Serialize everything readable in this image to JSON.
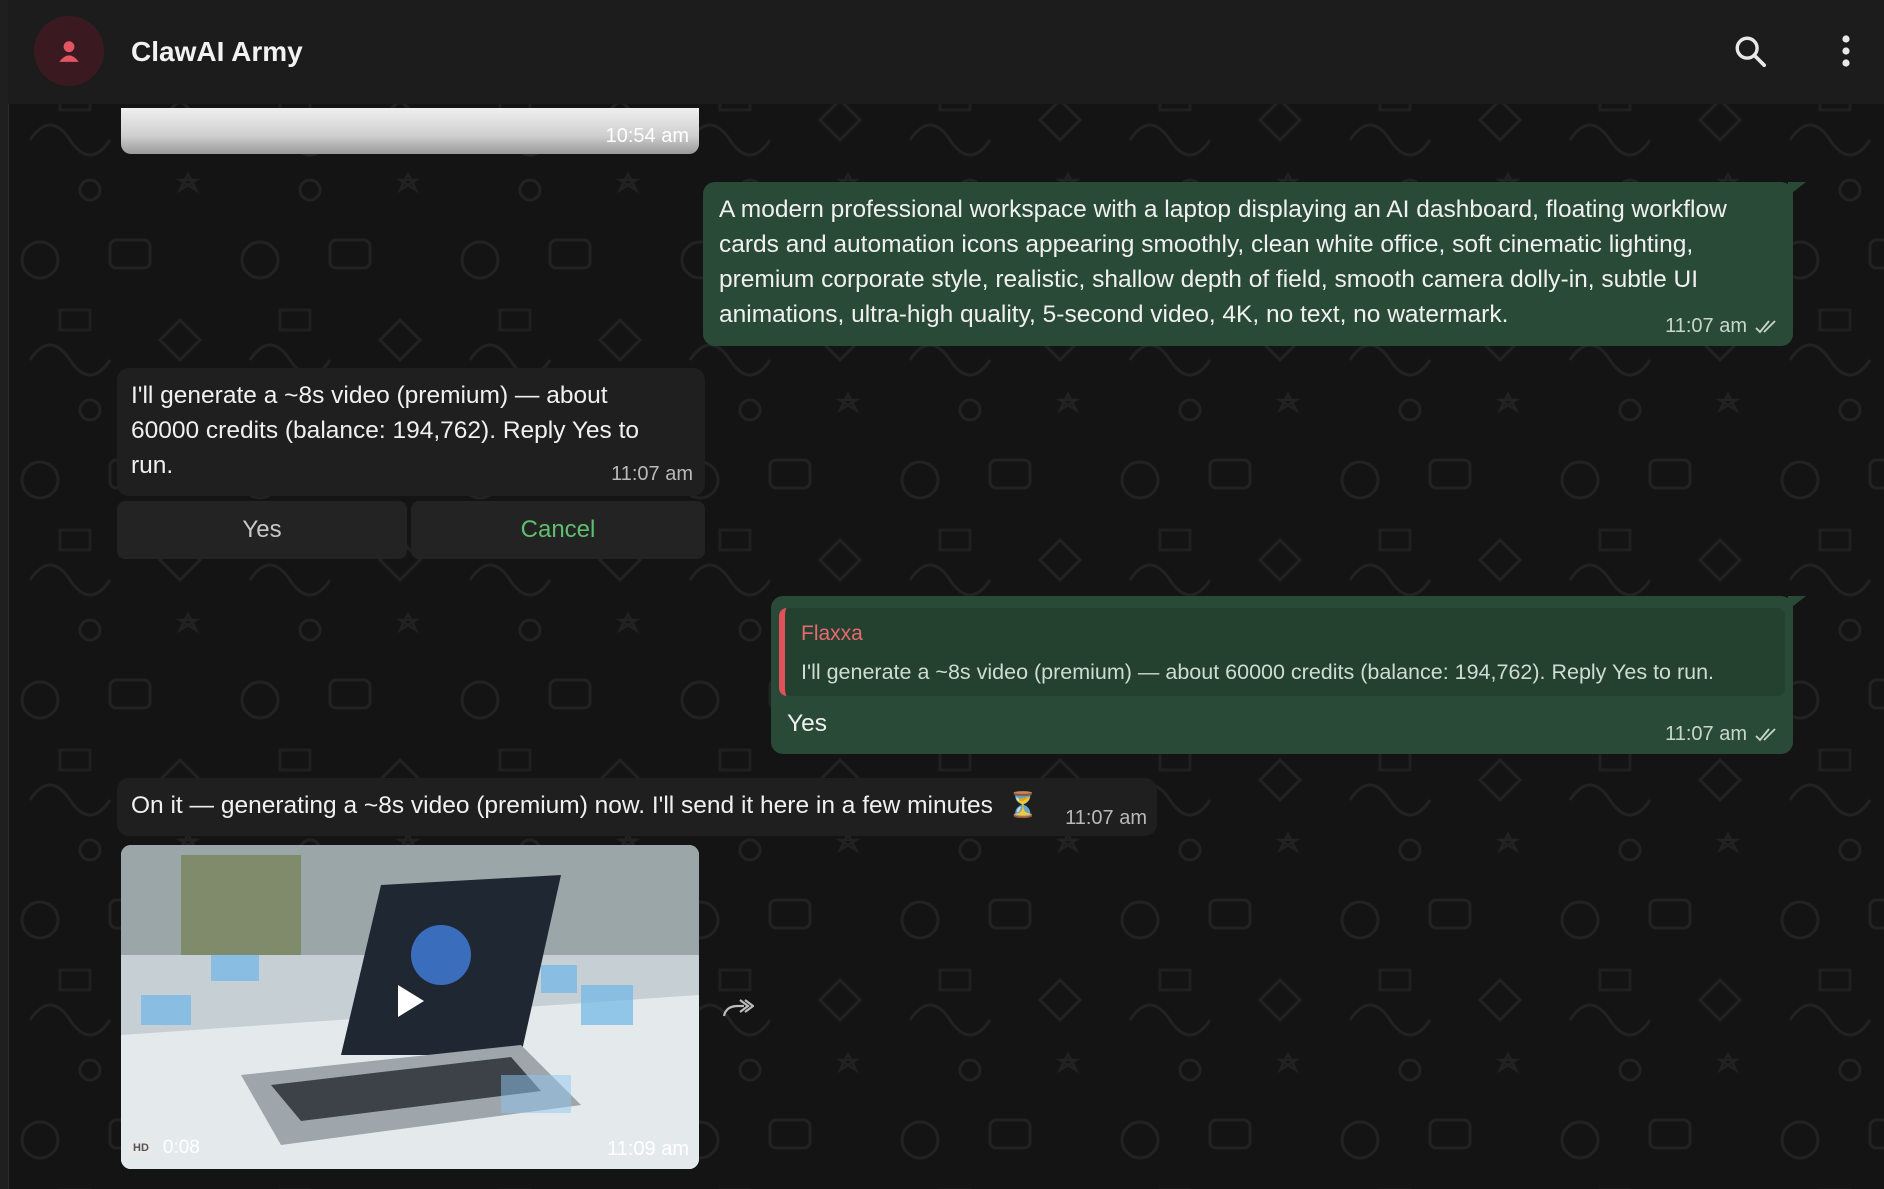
{
  "chat": {
    "title": "ClawAI Army"
  },
  "messages": {
    "partial_media_time": "10:54 am",
    "prompt": {
      "text": "A modern professional workspace with a laptop displaying an AI dashboard, floating workflow cards and automation icons appearing smoothly, clean white office, soft cinematic lighting, premium corporate style, realistic, shallow depth of field, smooth camera dolly-in, subtle UI animations, ultra-high quality, 5-second video, 4K, no text, no watermark.",
      "lines": [
        "A modern professional workspace with a laptop displaying an AI dashboard, floating workflow",
        "cards and automation icons appearing smoothly, clean white office, soft cinematic lighting,",
        "premium corporate style, realistic, shallow depth of field, smooth camera dolly-in, subtle UI",
        "animations, ultra-high quality, 5-second video, 4K, no text, no watermark."
      ],
      "time": "11:07 am"
    },
    "confirm": {
      "lines": [
        "I'll generate a ~8s video (premium) — about",
        "60000 credits (balance: 194,762). Reply Yes to",
        "run."
      ],
      "time": "11:07 am",
      "yes_label": "Yes",
      "cancel_label": "Cancel"
    },
    "reply": {
      "quote_author": "Flaxxa",
      "quote_text": "I'll generate a ~8s video (premium) — about 60000 credits (balance: 194,762). Reply Yes to run.",
      "text": "Yes",
      "time": "11:07 am"
    },
    "status": {
      "text": "On it — generating a ~8s video (premium) now. I'll send it here in a few minutes",
      "emoji": "⏳",
      "time": "11:07 am"
    },
    "video": {
      "quality": "HD",
      "duration": "0:08",
      "time": "11:09 am"
    }
  },
  "colors": {
    "outgoing_bubble": "#2a4a38",
    "incoming_bubble": "#1f1f1f",
    "cancel_text": "#5fbf6f",
    "quote_accent": "#e0515a"
  }
}
